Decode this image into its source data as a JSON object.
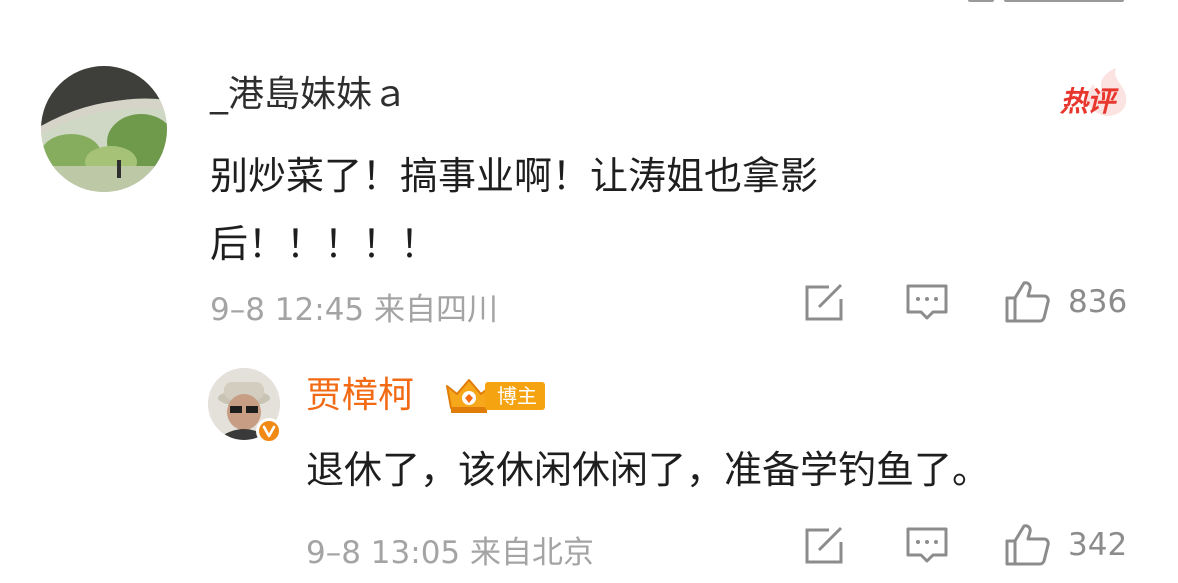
{
  "comments": [
    {
      "username": "_港島妹妹ａ",
      "hot_badge": "热评",
      "text": "别炒菜了！搞事业啊！让涛姐也拿影后！！！！！",
      "time": "9–8 12:45",
      "location": "来自四川",
      "like_count": "836"
    }
  ],
  "reply": {
    "username": "贾樟柯",
    "badge": "博主",
    "text": "退休了，该休闲休闲了，准备学钓鱼了。",
    "time": "9–8 13:05",
    "location": "来自北京",
    "like_count": "342"
  },
  "icons": {
    "share": "share-icon",
    "comment": "comment-icon",
    "like": "thumbs-up-icon",
    "verified": "verified-v-icon",
    "blogger_crown": "crown-icon"
  },
  "colors": {
    "blogger_name": "#f26b14",
    "hot_badge": "#e8372e",
    "blogger_badge": "#f5a311",
    "meta_text": "#a4a4a4"
  }
}
